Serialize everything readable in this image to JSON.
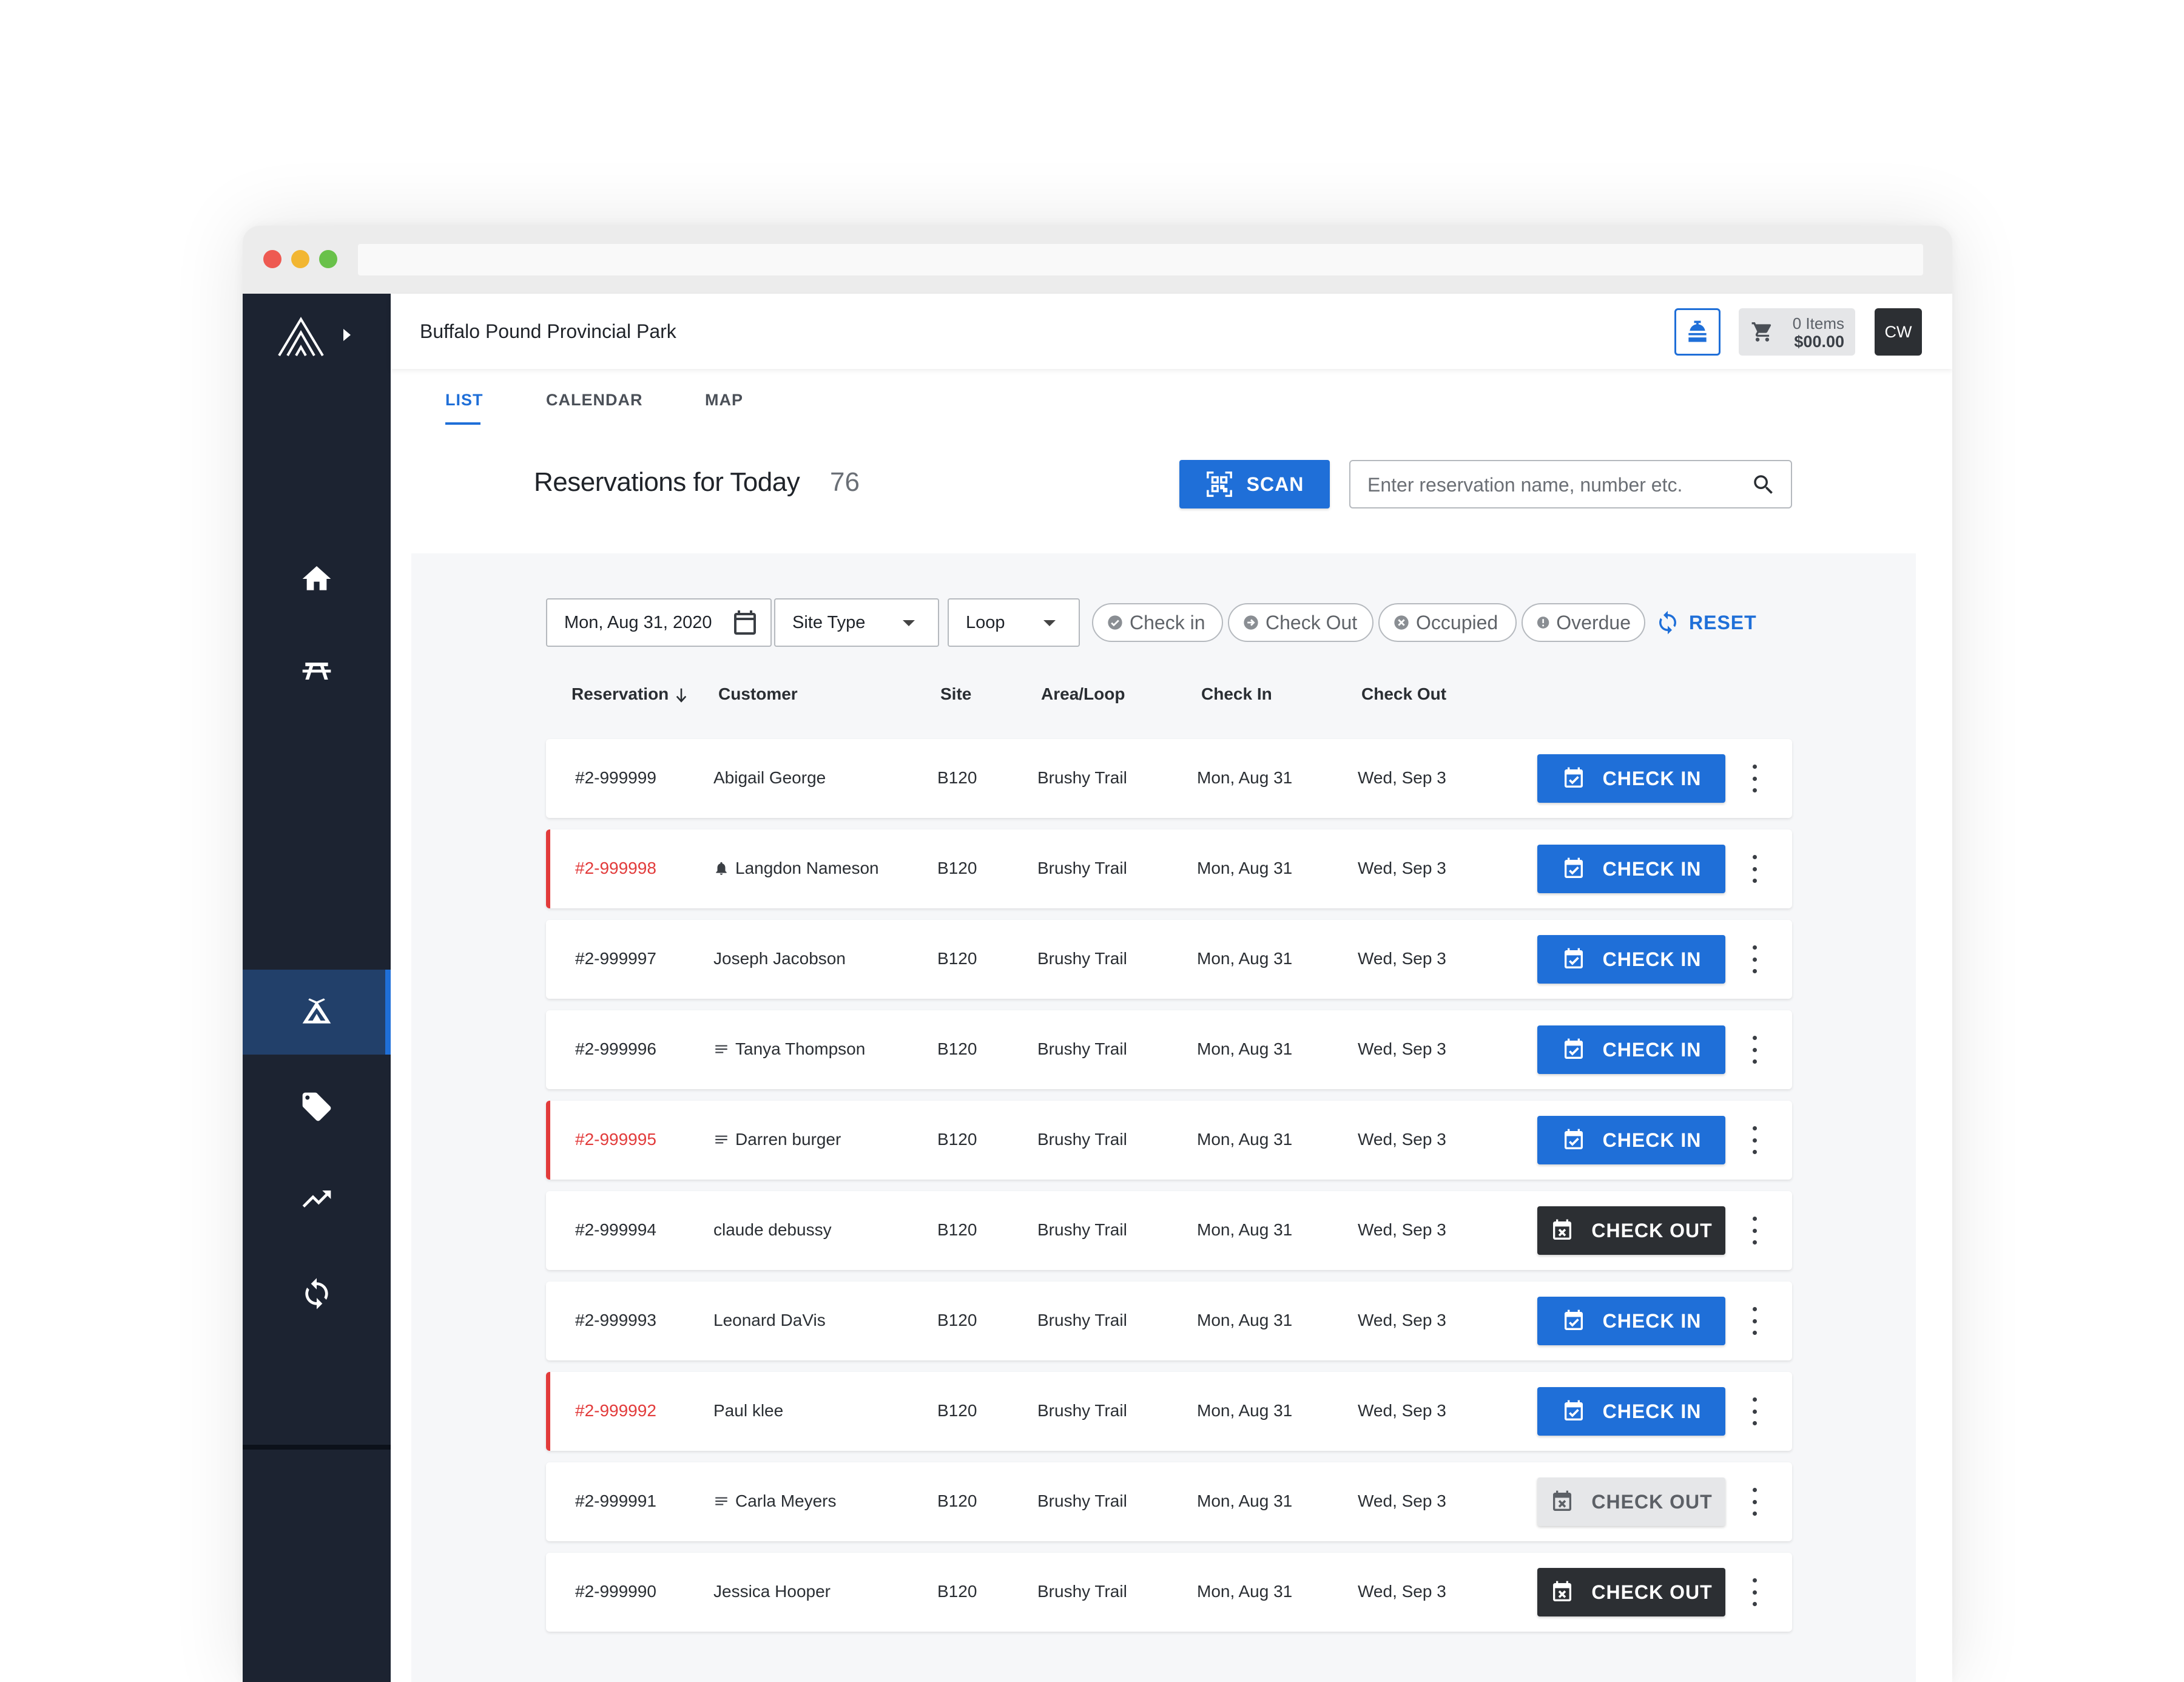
{
  "window": {
    "address": ""
  },
  "colors": {
    "accent": "#1f6fd8",
    "sidebar": "#1c2331",
    "flag": "#e23b3b",
    "dark_button": "#2c2f33"
  },
  "sidebar": {
    "items": [
      {
        "icon": "home-icon",
        "active": false
      },
      {
        "icon": "picnic-table-icon",
        "active": false
      },
      {
        "icon": "tent-icon",
        "active": true
      },
      {
        "icon": "tag-icon",
        "active": false
      },
      {
        "icon": "trending-up-icon",
        "active": false
      },
      {
        "icon": "sync-icon",
        "active": false
      }
    ]
  },
  "header": {
    "park_name": "Buffalo Pound Provincial Park",
    "cart_items": "0 Items",
    "cart_total": "$00.00",
    "user_initials": "CW"
  },
  "tabs": [
    {
      "label": "LIST",
      "active": true
    },
    {
      "label": "CALENDAR",
      "active": false
    },
    {
      "label": "MAP",
      "active": false
    }
  ],
  "page": {
    "title": "Reservations for Today",
    "count": "76",
    "scan_label": "SCAN",
    "search_placeholder": "Enter reservation name, number etc."
  },
  "filters": {
    "date": "Mon, Aug 31, 2020",
    "site_type": "Site Type",
    "loop": "Loop",
    "chips": [
      "Check in",
      "Check Out",
      "Occupied",
      "Overdue"
    ],
    "reset_label": "RESET"
  },
  "table": {
    "columns": [
      "Reservation",
      "Customer",
      "Site",
      "Area/Loop",
      "Check In",
      "Check Out"
    ],
    "rows": [
      {
        "reservation": "#2-999999",
        "customer": "Abigail George",
        "site": "B120",
        "area": "Brushy Trail",
        "check_in": "Mon, Aug 31",
        "check_out": "Wed, Sep 3",
        "action": "CHECK IN",
        "action_type": "in",
        "flagged": false,
        "note_icon": ""
      },
      {
        "reservation": "#2-999998",
        "customer": "Langdon Nameson",
        "site": "B120",
        "area": "Brushy Trail",
        "check_in": "Mon, Aug 31",
        "check_out": "Wed, Sep 3",
        "action": "CHECK IN",
        "action_type": "in",
        "flagged": true,
        "note_icon": "bell-icon"
      },
      {
        "reservation": "#2-999997",
        "customer": "Joseph Jacobson",
        "site": "B120",
        "area": "Brushy Trail",
        "check_in": "Mon, Aug 31",
        "check_out": "Wed, Sep 3",
        "action": "CHECK IN",
        "action_type": "in",
        "flagged": false,
        "note_icon": ""
      },
      {
        "reservation": "#2-999996",
        "customer": "Tanya Thompson",
        "site": "B120",
        "area": "Brushy Trail",
        "check_in": "Mon, Aug 31",
        "check_out": "Wed, Sep 3",
        "action": "CHECK IN",
        "action_type": "in",
        "flagged": false,
        "note_icon": "notes-icon"
      },
      {
        "reservation": "#2-999995",
        "customer": "Darren burger",
        "site": "B120",
        "area": "Brushy Trail",
        "check_in": "Mon, Aug 31",
        "check_out": "Wed, Sep 3",
        "action": "CHECK IN",
        "action_type": "in",
        "flagged": true,
        "note_icon": "notes-icon"
      },
      {
        "reservation": "#2-999994",
        "customer": "claude debussy",
        "site": "B120",
        "area": "Brushy Trail",
        "check_in": "Mon, Aug 31",
        "check_out": "Wed, Sep 3",
        "action": "CHECK OUT",
        "action_type": "out",
        "flagged": false,
        "note_icon": ""
      },
      {
        "reservation": "#2-999993",
        "customer": "Leonard DaVis",
        "site": "B120",
        "area": "Brushy Trail",
        "check_in": "Mon, Aug 31",
        "check_out": "Wed, Sep 3",
        "action": "CHECK IN",
        "action_type": "in",
        "flagged": false,
        "note_icon": ""
      },
      {
        "reservation": "#2-999992",
        "customer": "Paul klee",
        "site": "B120",
        "area": "Brushy Trail",
        "check_in": "Mon, Aug 31",
        "check_out": "Wed, Sep 3",
        "action": "CHECK IN",
        "action_type": "in",
        "flagged": true,
        "note_icon": ""
      },
      {
        "reservation": "#2-999991",
        "customer": "Carla Meyers",
        "site": "B120",
        "area": "Brushy Trail",
        "check_in": "Mon, Aug 31",
        "check_out": "Wed, Sep 3",
        "action": "CHECK OUT",
        "action_type": "out-muted",
        "flagged": false,
        "note_icon": "notes-icon"
      },
      {
        "reservation": "#2-999990",
        "customer": "Jessica Hooper",
        "site": "B120",
        "area": "Brushy Trail",
        "check_in": "Mon, Aug 31",
        "check_out": "Wed, Sep 3",
        "action": "CHECK OUT",
        "action_type": "out",
        "flagged": false,
        "note_icon": ""
      }
    ]
  }
}
